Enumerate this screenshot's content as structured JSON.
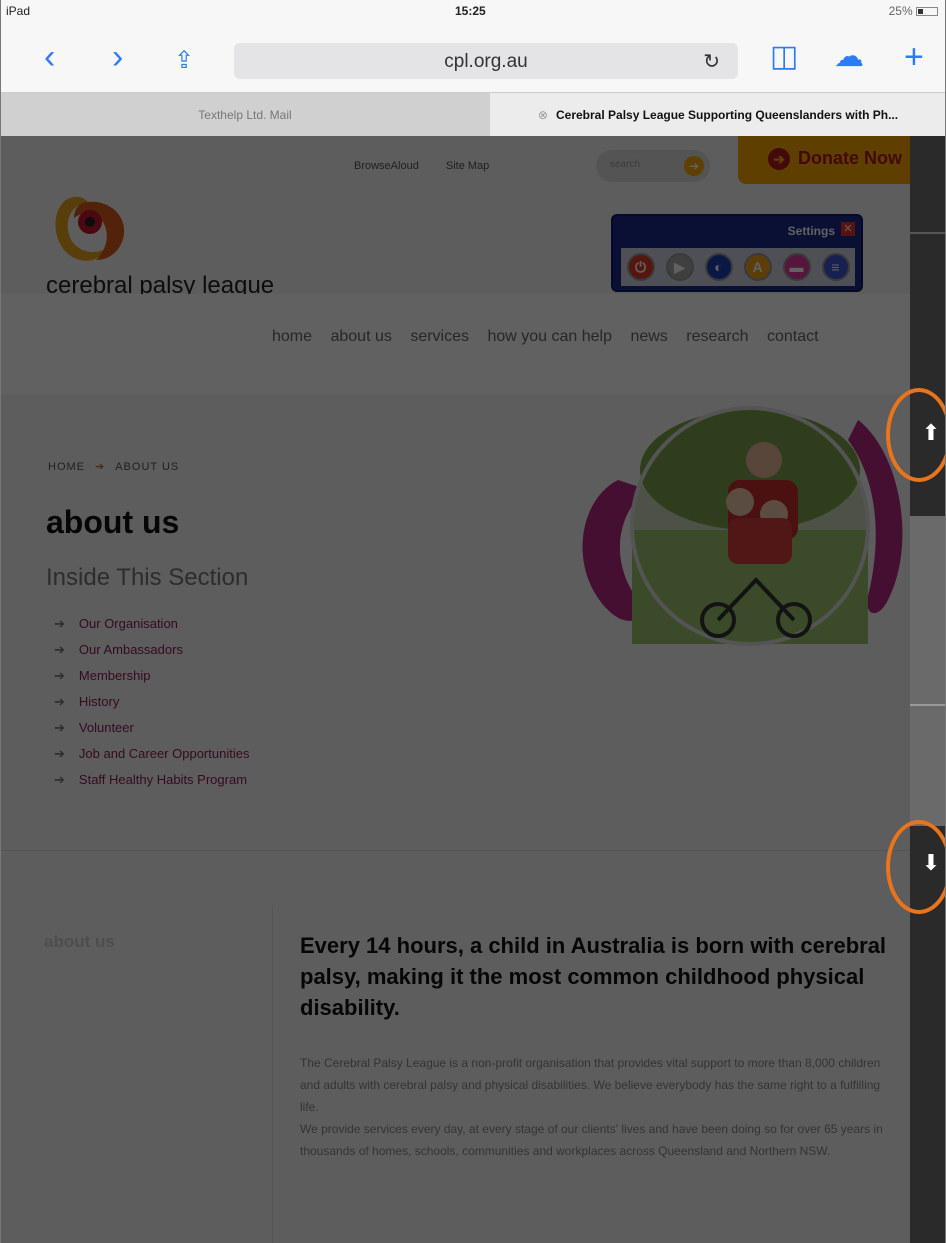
{
  "status": {
    "device": "iPad",
    "time": "15:25",
    "battery": "25%"
  },
  "toolbar": {
    "url": "cpl.org.au",
    "back": "‹",
    "forward": "›",
    "share": "⇪",
    "reload": "↻",
    "bookmarks": "◫",
    "cloud": "☁",
    "new_tab": "+"
  },
  "tabs": [
    {
      "label": "Texthelp Ltd. Mail"
    },
    {
      "label": "Cerebral Palsy League Supporting Queenslanders with Ph...",
      "close": "⊗"
    }
  ],
  "site": {
    "top_links": [
      "BrowseAloud",
      "Site Map"
    ],
    "search_placeholder": "search",
    "donate_label": "Donate Now",
    "logo_text": "cerebral palsy league",
    "toolbar_widget": {
      "title": "Settings",
      "close": "✕"
    },
    "nav": [
      "home",
      "about us",
      "services",
      "how you can help",
      "news",
      "research",
      "contact"
    ],
    "breadcrumb": [
      "HOME",
      "ABOUT US"
    ],
    "page_title": "about us",
    "section_title": "Inside This Section",
    "submenu": [
      "Our Organisation",
      "Our Ambassadors",
      "Membership",
      "History",
      "Volunteer",
      "Job and Career Opportunities",
      "Staff Healthy Habits Program"
    ],
    "side_label": "about us",
    "headline": "Every 14 hours, a child in Australia is born with cerebral palsy, making it the most common childhood physical disability.",
    "paragraph1": "The Cerebral Palsy League is a non-profit organisation that provides vital support to more than 8,000 children and adults with cerebral palsy and physical disabilities. We believe everybody has the same right to a fulfilling life.",
    "paragraph2": "We provide services every day, at every stage of our clients' lives and have been doing so for over 65 years in thousands of homes, schools, communities and workplaces across Queensland and Northern NSW."
  },
  "scroll_panel": {
    "up_icon": "⬆",
    "down_icon": "⬇"
  },
  "colors": {
    "accent_orange": "#e8741b",
    "brand_purple": "#8b1c5b",
    "safari_blue": "#2b7cf6"
  }
}
